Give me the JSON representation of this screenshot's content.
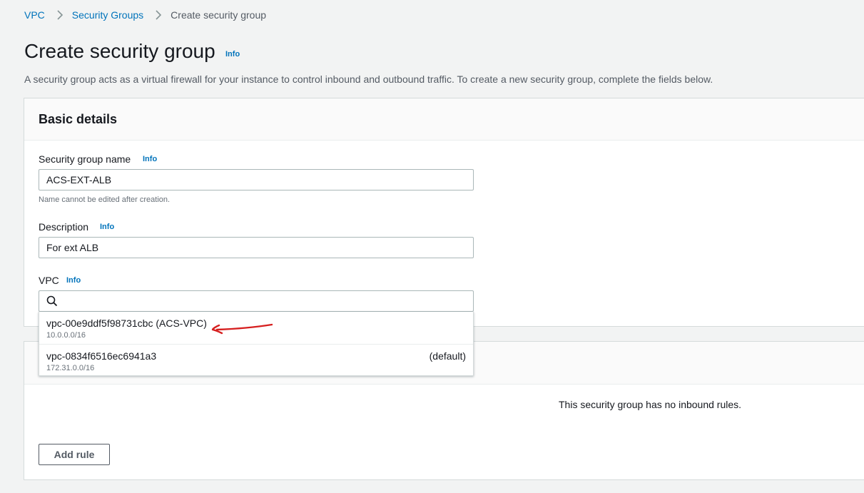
{
  "breadcrumb": {
    "items": [
      "VPC",
      "Security Groups"
    ],
    "current": "Create security group"
  },
  "header": {
    "title": "Create security group",
    "info_label": "Info",
    "description": "A security group acts as a virtual firewall for your instance to control inbound and outbound traffic. To create a new security group, complete the fields below."
  },
  "basic_details": {
    "title": "Basic details",
    "name_field": {
      "label": "Security group name",
      "info_label": "Info",
      "value": "ACS-EXT-ALB",
      "hint": "Name cannot be edited after creation."
    },
    "description_field": {
      "label": "Description",
      "info_label": "Info",
      "value": "For ext ALB"
    },
    "vpc_field": {
      "label": "VPC",
      "info_label": "Info",
      "search_value": "",
      "search_icon": "search-icon"
    }
  },
  "vpc_dropdown": {
    "options": [
      {
        "id": "vpc-00e9ddf5f98731cbc (ACS-VPC)",
        "cidr": "10.0.0.0/16",
        "tag": ""
      },
      {
        "id": "vpc-0834f6516ec6941a3",
        "cidr": "172.31.0.0/16",
        "tag": "(default)"
      }
    ]
  },
  "inbound_rules": {
    "empty_message": "This security group has no inbound rules.",
    "add_rule_label": "Add rule"
  },
  "annotation": {
    "color": "#d61f1f",
    "shape": "arrow"
  },
  "colors": {
    "link": "#0073bb",
    "page_bg": "#f2f3f3",
    "panel_bg": "#ffffff"
  }
}
